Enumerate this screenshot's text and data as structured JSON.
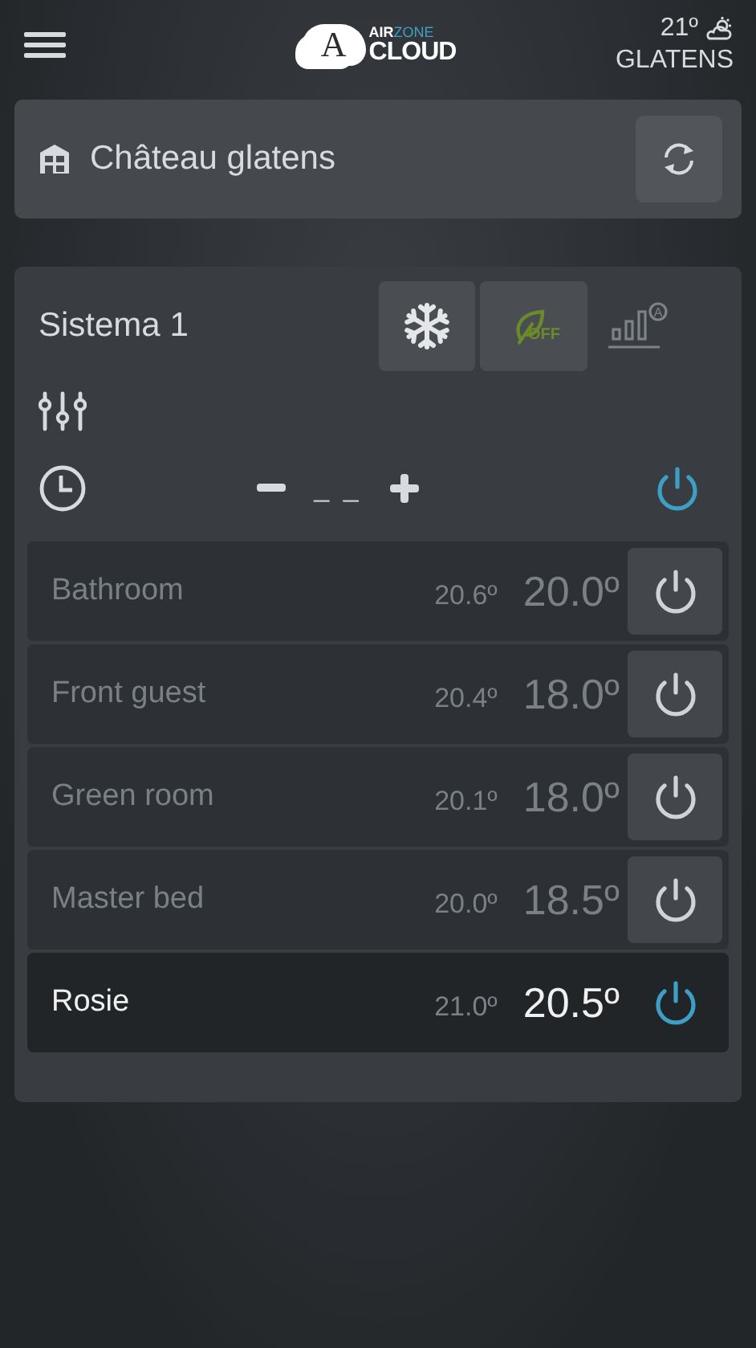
{
  "header": {
    "logo": {
      "letter": "A",
      "air": "AIR",
      "zone": "ZONE",
      "cloud": "CLOUD"
    },
    "weather": {
      "temperature": "21º",
      "city": "GLATENS"
    }
  },
  "installation": {
    "name": "Château glatens"
  },
  "system": {
    "name": "Sistema 1",
    "modes": [
      {
        "kind": "cool",
        "selected": true
      },
      {
        "kind": "eco",
        "label": "OFF",
        "selected": true
      },
      {
        "kind": "fan",
        "label": "A",
        "selected": false
      }
    ],
    "setpoint": "_ _",
    "on": true,
    "zones": [
      {
        "name": "Bathroom",
        "current": "20.6º",
        "setpoint": "20.0º",
        "on": false
      },
      {
        "name": "Front guest",
        "current": "20.4º",
        "setpoint": "18.0º",
        "on": false
      },
      {
        "name": "Green room",
        "current": "20.1º",
        "setpoint": "18.0º",
        "on": false
      },
      {
        "name": "Master bed",
        "current": "20.0º",
        "setpoint": "18.5º",
        "on": false
      },
      {
        "name": "Rosie",
        "current": "21.0º",
        "setpoint": "20.5º",
        "on": true
      }
    ]
  }
}
